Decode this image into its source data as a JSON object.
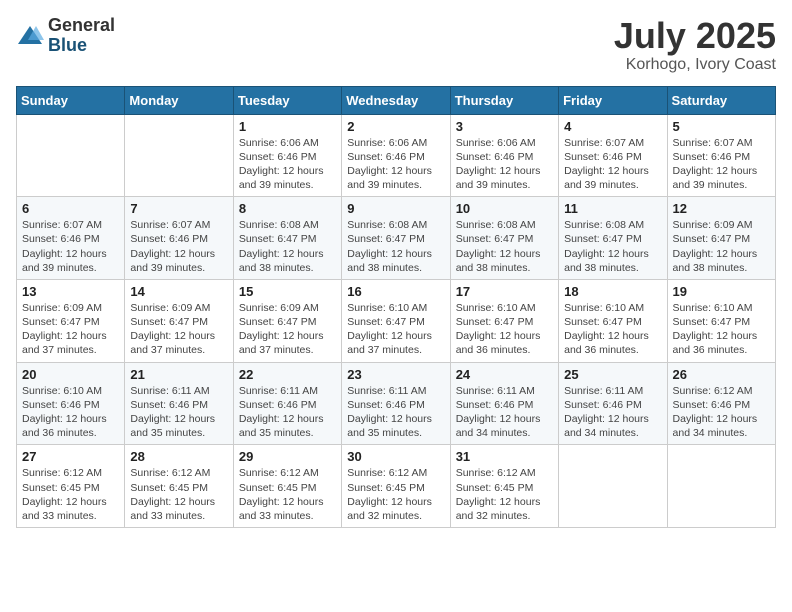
{
  "header": {
    "logo_general": "General",
    "logo_blue": "Blue",
    "month": "July 2025",
    "location": "Korhogo, Ivory Coast"
  },
  "days_of_week": [
    "Sunday",
    "Monday",
    "Tuesday",
    "Wednesday",
    "Thursday",
    "Friday",
    "Saturday"
  ],
  "weeks": [
    [
      {
        "day": "",
        "detail": ""
      },
      {
        "day": "",
        "detail": ""
      },
      {
        "day": "1",
        "detail": "Sunrise: 6:06 AM\nSunset: 6:46 PM\nDaylight: 12 hours and 39 minutes."
      },
      {
        "day": "2",
        "detail": "Sunrise: 6:06 AM\nSunset: 6:46 PM\nDaylight: 12 hours and 39 minutes."
      },
      {
        "day": "3",
        "detail": "Sunrise: 6:06 AM\nSunset: 6:46 PM\nDaylight: 12 hours and 39 minutes."
      },
      {
        "day": "4",
        "detail": "Sunrise: 6:07 AM\nSunset: 6:46 PM\nDaylight: 12 hours and 39 minutes."
      },
      {
        "day": "5",
        "detail": "Sunrise: 6:07 AM\nSunset: 6:46 PM\nDaylight: 12 hours and 39 minutes."
      }
    ],
    [
      {
        "day": "6",
        "detail": "Sunrise: 6:07 AM\nSunset: 6:46 PM\nDaylight: 12 hours and 39 minutes."
      },
      {
        "day": "7",
        "detail": "Sunrise: 6:07 AM\nSunset: 6:46 PM\nDaylight: 12 hours and 39 minutes."
      },
      {
        "day": "8",
        "detail": "Sunrise: 6:08 AM\nSunset: 6:47 PM\nDaylight: 12 hours and 38 minutes."
      },
      {
        "day": "9",
        "detail": "Sunrise: 6:08 AM\nSunset: 6:47 PM\nDaylight: 12 hours and 38 minutes."
      },
      {
        "day": "10",
        "detail": "Sunrise: 6:08 AM\nSunset: 6:47 PM\nDaylight: 12 hours and 38 minutes."
      },
      {
        "day": "11",
        "detail": "Sunrise: 6:08 AM\nSunset: 6:47 PM\nDaylight: 12 hours and 38 minutes."
      },
      {
        "day": "12",
        "detail": "Sunrise: 6:09 AM\nSunset: 6:47 PM\nDaylight: 12 hours and 38 minutes."
      }
    ],
    [
      {
        "day": "13",
        "detail": "Sunrise: 6:09 AM\nSunset: 6:47 PM\nDaylight: 12 hours and 37 minutes."
      },
      {
        "day": "14",
        "detail": "Sunrise: 6:09 AM\nSunset: 6:47 PM\nDaylight: 12 hours and 37 minutes."
      },
      {
        "day": "15",
        "detail": "Sunrise: 6:09 AM\nSunset: 6:47 PM\nDaylight: 12 hours and 37 minutes."
      },
      {
        "day": "16",
        "detail": "Sunrise: 6:10 AM\nSunset: 6:47 PM\nDaylight: 12 hours and 37 minutes."
      },
      {
        "day": "17",
        "detail": "Sunrise: 6:10 AM\nSunset: 6:47 PM\nDaylight: 12 hours and 36 minutes."
      },
      {
        "day": "18",
        "detail": "Sunrise: 6:10 AM\nSunset: 6:47 PM\nDaylight: 12 hours and 36 minutes."
      },
      {
        "day": "19",
        "detail": "Sunrise: 6:10 AM\nSunset: 6:47 PM\nDaylight: 12 hours and 36 minutes."
      }
    ],
    [
      {
        "day": "20",
        "detail": "Sunrise: 6:10 AM\nSunset: 6:46 PM\nDaylight: 12 hours and 36 minutes."
      },
      {
        "day": "21",
        "detail": "Sunrise: 6:11 AM\nSunset: 6:46 PM\nDaylight: 12 hours and 35 minutes."
      },
      {
        "day": "22",
        "detail": "Sunrise: 6:11 AM\nSunset: 6:46 PM\nDaylight: 12 hours and 35 minutes."
      },
      {
        "day": "23",
        "detail": "Sunrise: 6:11 AM\nSunset: 6:46 PM\nDaylight: 12 hours and 35 minutes."
      },
      {
        "day": "24",
        "detail": "Sunrise: 6:11 AM\nSunset: 6:46 PM\nDaylight: 12 hours and 34 minutes."
      },
      {
        "day": "25",
        "detail": "Sunrise: 6:11 AM\nSunset: 6:46 PM\nDaylight: 12 hours and 34 minutes."
      },
      {
        "day": "26",
        "detail": "Sunrise: 6:12 AM\nSunset: 6:46 PM\nDaylight: 12 hours and 34 minutes."
      }
    ],
    [
      {
        "day": "27",
        "detail": "Sunrise: 6:12 AM\nSunset: 6:45 PM\nDaylight: 12 hours and 33 minutes."
      },
      {
        "day": "28",
        "detail": "Sunrise: 6:12 AM\nSunset: 6:45 PM\nDaylight: 12 hours and 33 minutes."
      },
      {
        "day": "29",
        "detail": "Sunrise: 6:12 AM\nSunset: 6:45 PM\nDaylight: 12 hours and 33 minutes."
      },
      {
        "day": "30",
        "detail": "Sunrise: 6:12 AM\nSunset: 6:45 PM\nDaylight: 12 hours and 32 minutes."
      },
      {
        "day": "31",
        "detail": "Sunrise: 6:12 AM\nSunset: 6:45 PM\nDaylight: 12 hours and 32 minutes."
      },
      {
        "day": "",
        "detail": ""
      },
      {
        "day": "",
        "detail": ""
      }
    ]
  ]
}
